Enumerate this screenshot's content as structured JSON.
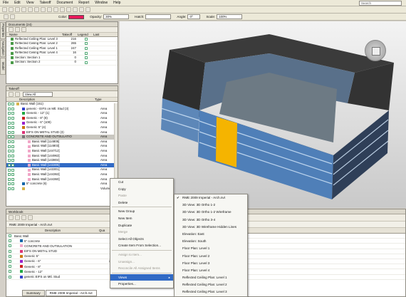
{
  "menubar": {
    "items": [
      "File",
      "Edit",
      "View",
      "Takeoff",
      "Document",
      "Report",
      "Window",
      "Help"
    ],
    "search_placeholder": "Search"
  },
  "stylebar": {
    "color_label": "Color:",
    "color_value": "#e8185a",
    "opacity_label": "Opacity:",
    "opacity_value": "30%",
    "hatch_label": "Hatch:",
    "angle_label": "Angle:",
    "angle_value": "0º",
    "scale_label": "Scale:",
    "scale_value": "100%"
  },
  "side_tabs": [
    "Properties",
    "Navigation",
    "Model"
  ],
  "documents": {
    "title": "Documents (24)",
    "columns": [
      "Name",
      "Takeoff",
      "Legend",
      "Last"
    ],
    "rows": [
      {
        "name": "Reflected Ceiling Plan: Level 3",
        "takeoff": "216"
      },
      {
        "name": "Reflected Ceiling Plan: Level 2",
        "takeoff": "265"
      },
      {
        "name": "Reflected Ceiling Plan: Level 1",
        "takeoff": "247"
      },
      {
        "name": "Reflected Ceiling Plan: Level 4",
        "takeoff": "16"
      },
      {
        "name": "Section: Section 1",
        "takeoff": "0"
      },
      {
        "name": "Section: Section 2",
        "takeoff": "0"
      }
    ]
  },
  "takeoff": {
    "title": "Takeoff",
    "view_filter": "View All",
    "columns": [
      "Description",
      "Type"
    ],
    "rows": [
      {
        "indent": 0,
        "label": "Basic Wall (151)",
        "type": "",
        "color": "",
        "selected": false
      },
      {
        "indent": 1,
        "label": "generic - EIFS on Mtl. Stud (3)",
        "type": "Area",
        "color": "#3344cc",
        "selected": false
      },
      {
        "indent": 1,
        "label": "Generic - 12\" (1)",
        "type": "Area",
        "color": "#22aa44",
        "selected": false
      },
      {
        "indent": 1,
        "label": "Generic - 8\" (8)",
        "type": "Area",
        "color": "#cc2222",
        "selected": false
      },
      {
        "indent": 1,
        "label": "Generic - 6\" (109)",
        "type": "Area",
        "color": "#9922cc",
        "selected": false
      },
      {
        "indent": 1,
        "label": "Generic 5\" (4)",
        "type": "Area",
        "color": "#cc7711",
        "selected": false
      },
      {
        "indent": 1,
        "label": "EIFS ON METAL STUD (3)",
        "type": "Area",
        "color": "#dd3377",
        "selected": false
      },
      {
        "indent": 1,
        "label": "CONCRETE AND OUTSULATIO",
        "type": "Area",
        "color": "#777777",
        "selected": false
      },
      {
        "indent": 2,
        "label": "Basic Wall [114805]",
        "type": "Area",
        "color": "#f1a7c8",
        "selected": false
      },
      {
        "indent": 2,
        "label": "Basic Wall [114803]",
        "type": "Area",
        "color": "#f1a7c8",
        "selected": false
      },
      {
        "indent": 2,
        "label": "Basic Wall [144712]",
        "type": "Area",
        "color": "#f1a7c8",
        "selected": false
      },
      {
        "indent": 2,
        "label": "Basic Wall [144963]",
        "type": "Area",
        "color": "#f1a7c8",
        "selected": false
      },
      {
        "indent": 2,
        "label": "Basic Wall [143804]",
        "type": "Area",
        "color": "#f1a7c8",
        "selected": false
      },
      {
        "indent": 2,
        "label": "Basic Wall [143305]",
        "type": "Area",
        "color": "#f1a7c8",
        "selected": true
      },
      {
        "indent": 2,
        "label": "Basic Wall [143301]",
        "type": "Area",
        "color": "#f1a7c8",
        "selected": false
      },
      {
        "indent": 2,
        "label": "Basic Wall [144363]",
        "type": "Area",
        "color": "#f1a7c8",
        "selected": false
      },
      {
        "indent": 2,
        "label": "Basic Wall [144360]",
        "type": "Area",
        "color": "#f1a7c8",
        "selected": false
      },
      {
        "indent": 1,
        "label": "5\" concrete (6)",
        "type": "Area",
        "color": "#1166aa",
        "selected": false
      },
      {
        "indent": 1,
        "label": "",
        "type": "Volume",
        "color": "",
        "selected": false
      }
    ]
  },
  "context_menu": {
    "items": [
      {
        "label": "Cut",
        "disabled": false,
        "sep": false
      },
      {
        "label": "Copy",
        "disabled": false,
        "sep": false
      },
      {
        "label": "Paste",
        "disabled": true,
        "sep": false
      },
      {
        "label": "Delete",
        "disabled": false,
        "sep": true
      },
      {
        "label": "New Group",
        "disabled": false,
        "sep": false
      },
      {
        "label": "New Item",
        "disabled": false,
        "sep": false
      },
      {
        "label": "Duplicate",
        "disabled": false,
        "sep": false
      },
      {
        "label": "Merge",
        "disabled": true,
        "sep": false
      },
      {
        "label": "Select All Objects",
        "disabled": false,
        "sep": false
      },
      {
        "label": "Create Item From Selection...",
        "disabled": false,
        "sep": true
      },
      {
        "label": "Assign to Item...",
        "disabled": true,
        "sep": false
      },
      {
        "label": "Unassign...",
        "disabled": true,
        "sep": false
      },
      {
        "label": "Reconcile All Assigned Items",
        "disabled": true,
        "sep": true
      },
      {
        "label": "Views",
        "disabled": false,
        "sep": false,
        "highlight": true,
        "submenu": true
      },
      {
        "label": "Properties...",
        "disabled": false,
        "sep": false
      }
    ]
  },
  "views_submenu": {
    "items": [
      {
        "label": "RME 2009 Imperial - Arch.nvt",
        "checked": true
      },
      {
        "label": "3D View: 3D Ortho 1-2"
      },
      {
        "label": "3D View: 3D Ortho 1-2 Wireframe"
      },
      {
        "label": "3D View: 3D Ortho 3-4"
      },
      {
        "label": "3D View: 3D Wireframe Hidden Lines"
      },
      {
        "label": "Elevation: East"
      },
      {
        "label": "Elevation: South"
      },
      {
        "label": "Floor Plan: Level 1"
      },
      {
        "label": "Floor Plan: Level 2"
      },
      {
        "label": "Floor Plan: Level 3"
      },
      {
        "label": "Floor Plan: Level 4"
      },
      {
        "label": "Reflected Ceiling Plan: Level 1"
      },
      {
        "label": "Reflected Ceiling Plan: Level 2"
      },
      {
        "label": "Reflected Ceiling Plan: Level 3"
      }
    ]
  },
  "workbook": {
    "title": "Workbook",
    "tab_title": "RME 2009 Imperial - Arch.nvt",
    "columns": [
      "Description",
      "Qua",
      "ms"
    ],
    "rows": [
      {
        "indent": 0,
        "label": "Basic Wall",
        "qty": "",
        "color": ""
      },
      {
        "indent": 1,
        "label": "5\" concrete",
        "qty": "2,193.0",
        "color": "#1166aa"
      },
      {
        "indent": 1,
        "label": "CONCRETE AND OUTSULATION",
        "qty": "4,463.5",
        "color": "#f1a7c8"
      },
      {
        "indent": 1,
        "label": "EIFS ON METAL STUD",
        "qty": "372.0",
        "color": "#dd3377"
      },
      {
        "indent": 1,
        "label": "Generic 5\"",
        "qty": "156.5",
        "color": "#cc7711"
      },
      {
        "indent": 1,
        "label": "Generic - 6\"",
        "qty": "26,905.8",
        "color": "#9922cc"
      },
      {
        "indent": 1,
        "label": "Generic - 8\"",
        "qty": "5,206.7",
        "color": "#cc2222"
      },
      {
        "indent": 1,
        "label": "Generic - 12\"",
        "qty": "361.6",
        "color": "#22aa44"
      },
      {
        "indent": 1,
        "label": "generic EIFS on Mtl. Stud",
        "qty": "2,284.0",
        "color": "#3344cc"
      }
    ],
    "bottom_tabs": [
      "Summary",
      "RME 2009 Imperial - Arch.nvt"
    ]
  }
}
